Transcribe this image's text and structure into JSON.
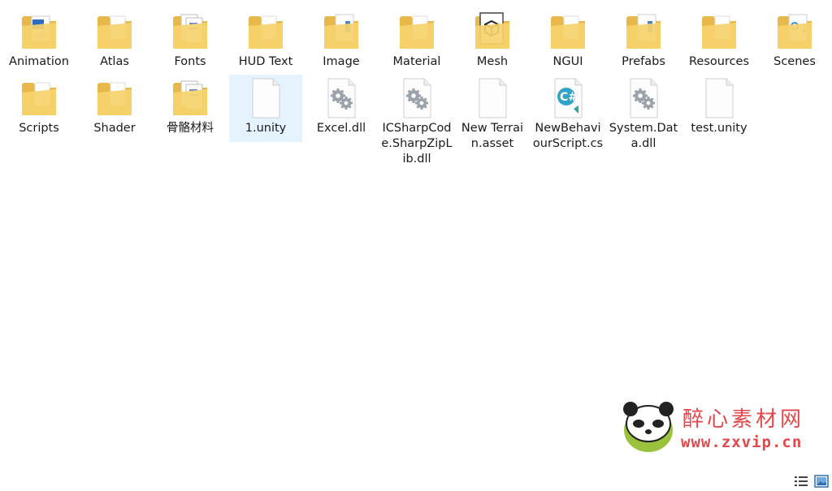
{
  "items": [
    {
      "label": "Animation",
      "icon": "folder-swf-icon",
      "kind": "folder",
      "selected": false
    },
    {
      "label": "Atlas",
      "icon": "folder-icon",
      "kind": "folder",
      "selected": false
    },
    {
      "label": "Fonts",
      "icon": "folder-docs-icon",
      "kind": "folder",
      "selected": false
    },
    {
      "label": "HUD Text",
      "icon": "folder-icon",
      "kind": "folder",
      "selected": false
    },
    {
      "label": "Image",
      "icon": "folder-doc-blue-icon",
      "kind": "folder",
      "selected": false
    },
    {
      "label": "Material",
      "icon": "folder-icon",
      "kind": "folder",
      "selected": false
    },
    {
      "label": "Mesh",
      "icon": "folder-3d-icon",
      "kind": "folder",
      "selected": false
    },
    {
      "label": "NGUI",
      "icon": "folder-icon",
      "kind": "folder",
      "selected": false
    },
    {
      "label": "Prefabs",
      "icon": "folder-doc-blue-icon",
      "kind": "folder",
      "selected": false
    },
    {
      "label": "Resources",
      "icon": "folder-icon",
      "kind": "folder",
      "selected": false
    },
    {
      "label": "Scenes",
      "icon": "folder-unity-icon",
      "kind": "folder",
      "selected": false
    },
    {
      "label": "Scripts",
      "icon": "folder-icon",
      "kind": "folder",
      "selected": false
    },
    {
      "label": "Shader",
      "icon": "folder-icon",
      "kind": "folder",
      "selected": false
    },
    {
      "label": "骨骼材料",
      "icon": "folder-docs-icon",
      "kind": "folder",
      "selected": false
    },
    {
      "label": "1.unity",
      "icon": "blank-file-icon",
      "kind": "file",
      "selected": true
    },
    {
      "label": "Excel.dll",
      "icon": "dll-gear-icon",
      "kind": "dll",
      "selected": false
    },
    {
      "label": "ICSharpCode.SharpZipLib.dll",
      "icon": "dll-gear-icon",
      "kind": "dll",
      "selected": false
    },
    {
      "label": "New Terrain.asset",
      "icon": "blank-file-icon",
      "kind": "file",
      "selected": false
    },
    {
      "label": "NewBehaviourScript.cs",
      "icon": "csharp-file-icon",
      "kind": "cs",
      "selected": false
    },
    {
      "label": "System.Data.dll",
      "icon": "dll-gear-icon",
      "kind": "dll",
      "selected": false
    },
    {
      "label": "test.unity",
      "icon": "blank-file-icon",
      "kind": "file",
      "selected": false
    }
  ],
  "watermark": {
    "title": "醉心素材网",
    "url": "www.zxvip.cn"
  },
  "colors": {
    "folder": "#f6d36b",
    "folder_dark": "#e8b84a",
    "selection": "#e5f3ff",
    "watermark": "#e1474b"
  },
  "view_buttons": [
    {
      "name": "details-view-icon"
    },
    {
      "name": "large-icons-view-icon"
    }
  ]
}
